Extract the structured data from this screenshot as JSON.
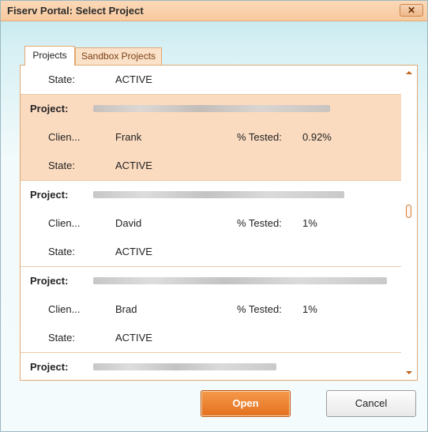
{
  "window": {
    "title": "Fiserv Portal: Select Project",
    "close_icon": "close-icon",
    "close_label": "✕"
  },
  "tabs": [
    {
      "label": "Projects",
      "active": true
    },
    {
      "label": "Sandbox Projects",
      "active": false
    }
  ],
  "list": {
    "labels": {
      "project": "Project:",
      "client": "Clien...",
      "state": "State:",
      "tested": "% Tested:"
    },
    "top_state": "ACTIVE",
    "items": [
      {
        "project_name": "[redacted]",
        "client": "Frank",
        "tested": "0.92%",
        "state": "ACTIVE",
        "selected": true
      },
      {
        "project_name": "[redacted]",
        "client": "David",
        "tested": "1%",
        "state": "ACTIVE",
        "selected": false
      },
      {
        "project_name": "[redacted]",
        "client": "Brad",
        "tested": "1%",
        "state": "ACTIVE",
        "selected": false
      },
      {
        "project_name": "[redacted]",
        "selected": false
      }
    ]
  },
  "buttons": {
    "open": "Open",
    "cancel": "Cancel"
  },
  "colors": {
    "accent": "#e3701f",
    "selected_row": "#fbdbc0",
    "title_bar": "#f8c99e"
  }
}
